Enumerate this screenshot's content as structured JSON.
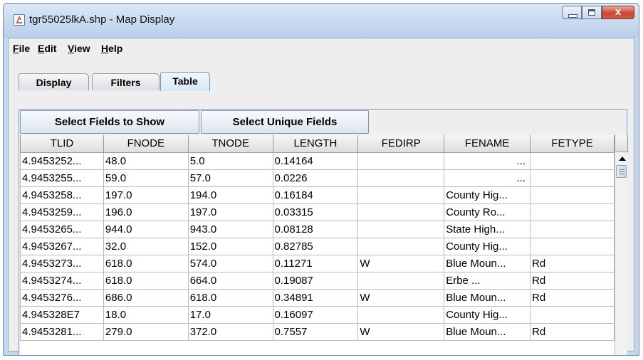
{
  "window": {
    "title": "tgr55025lkA.shp - Map Display",
    "close_glyph": "x"
  },
  "menubar": {
    "items": [
      {
        "mnemonic": "F",
        "rest": "ile"
      },
      {
        "mnemonic": "E",
        "rest": "dit"
      },
      {
        "mnemonic": "V",
        "rest": "iew"
      },
      {
        "mnemonic": "H",
        "rest": "elp"
      }
    ]
  },
  "tabs": [
    {
      "label": "Display"
    },
    {
      "label": "Filters"
    },
    {
      "label": "Table",
      "selected": true
    }
  ],
  "toolbar": {
    "select_fields_label": "Select Fields to Show",
    "select_unique_label": "Select Unique Fields"
  },
  "table": {
    "columns": [
      "TLID",
      "FNODE",
      "TNODE",
      "LENGTH",
      "FEDIRP",
      "FENAME",
      "FETYPE"
    ],
    "rows": [
      [
        "4.9453252...",
        "48.0",
        "5.0",
        "0.14164",
        "",
        "...",
        ""
      ],
      [
        "4.9453255...",
        "59.0",
        "57.0",
        "0.0226",
        "",
        "...",
        ""
      ],
      [
        "4.9453258...",
        "197.0",
        "194.0",
        "0.16184",
        "",
        "County Hig...",
        ""
      ],
      [
        "4.9453259...",
        "196.0",
        "197.0",
        "0.03315",
        "",
        "County Ro...",
        ""
      ],
      [
        "4.9453265...",
        "944.0",
        "943.0",
        "0.08128",
        "",
        "State High...",
        ""
      ],
      [
        "4.9453267...",
        "32.0",
        "152.0",
        "0.82785",
        "",
        "County Hig...",
        ""
      ],
      [
        "4.9453273...",
        "618.0",
        "574.0",
        "0.11271",
        "W",
        "Blue Moun...",
        "Rd"
      ],
      [
        "4.9453274...",
        "618.0",
        "664.0",
        "0.19087",
        "",
        "Erbe        ...",
        "Rd"
      ],
      [
        "4.9453276...",
        "686.0",
        "618.0",
        "0.34891",
        "W",
        "Blue Moun...",
        "Rd"
      ],
      [
        "4.945328E7",
        "18.0",
        "17.0",
        "0.16097",
        "",
        "County Hig...",
        ""
      ],
      [
        "4.9453281...",
        "279.0",
        "372.0",
        "0.7557",
        "W",
        "Blue Moun...",
        "Rd"
      ]
    ]
  },
  "icons": {
    "app": "java-app-icon",
    "minimize": "minimize-icon",
    "maximize": "maximize-icon",
    "close": "close-icon",
    "scroll_up": "scroll-up-arrow-icon"
  },
  "colors": {
    "window_frame": "#c4d7ee",
    "close_button": "#c8452f",
    "active_tab": "#d9e6f6"
  }
}
